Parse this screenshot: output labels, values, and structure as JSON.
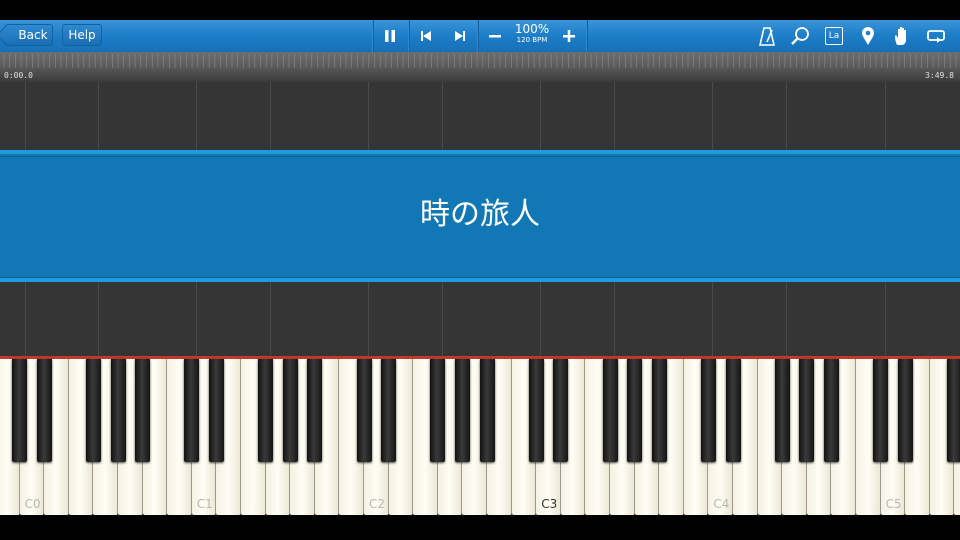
{
  "toolbar": {
    "back_label": "Back",
    "help_label": "Help",
    "tempo_percent": "100%",
    "tempo_bpm": "120 BPM",
    "icons": [
      "pause-icon",
      "skip-back-icon",
      "skip-forward-icon",
      "minus-icon",
      "plus-icon",
      "metronome-icon",
      "magnifier-icon",
      "label-icon",
      "location-pin-icon",
      "hand-icon",
      "loop-icon"
    ],
    "label_icon_text": "La"
  },
  "timeline": {
    "start": "0:00.0",
    "end": "3:49.8"
  },
  "song": {
    "title": "時の旅人"
  },
  "keyboard": {
    "octave_labels": [
      "C0",
      "C1",
      "C2",
      "C3",
      "C4",
      "C5"
    ],
    "highlighted_label": "C3",
    "accent_color": "#c0392b"
  },
  "colors": {
    "toolbar": "#1f7fc9",
    "banner": "#1178b5",
    "background": "#353535"
  }
}
